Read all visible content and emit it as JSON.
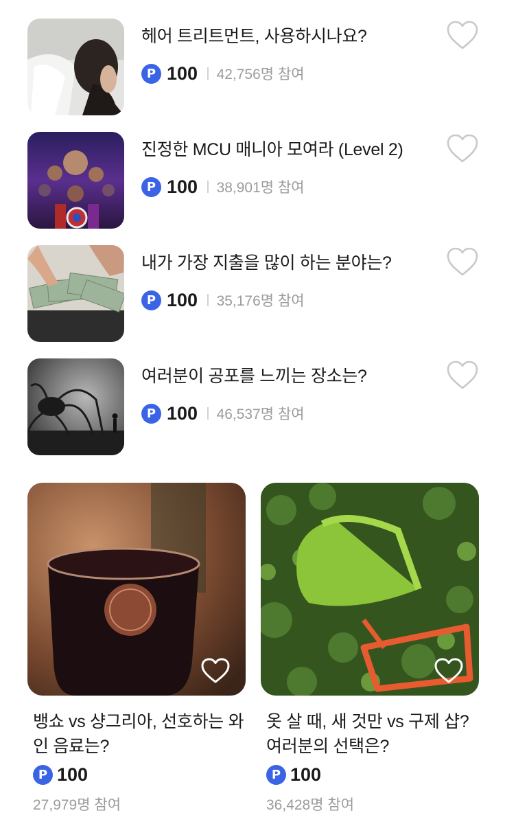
{
  "list": [
    {
      "title": "헤어 트리트먼트, 사용하시나요?",
      "points": "100",
      "participants": "42,756명 참여"
    },
    {
      "title": "진정한 MCU 매니아 모여라 (Level 2)",
      "points": "100",
      "participants": "38,901명 참여"
    },
    {
      "title": "내가 가장 지출을 많이 하는 분야는?",
      "points": "100",
      "participants": "35,176명 참여"
    },
    {
      "title": "여러분이 공포를 느끼는 장소는?",
      "points": "100",
      "participants": "46,537명 참여"
    }
  ],
  "cards": [
    {
      "title": "뱅쇼 vs 샹그리아, 선호하는 와인 음료는?",
      "points": "100",
      "participants": "27,979명 참여"
    },
    {
      "title": "옷 살 때, 새 것만 vs 구제 샵? 여러분의 선택은?",
      "points": "100",
      "participants": "36,428명 참여"
    }
  ],
  "badge_label": "P",
  "icons": {
    "point": "point-coin-icon",
    "like": "heart-outline-icon"
  },
  "colors": {
    "point_badge": "#3a63e6",
    "muted_text": "#9b9b9b",
    "heart_stroke": "#c9c9c9"
  }
}
